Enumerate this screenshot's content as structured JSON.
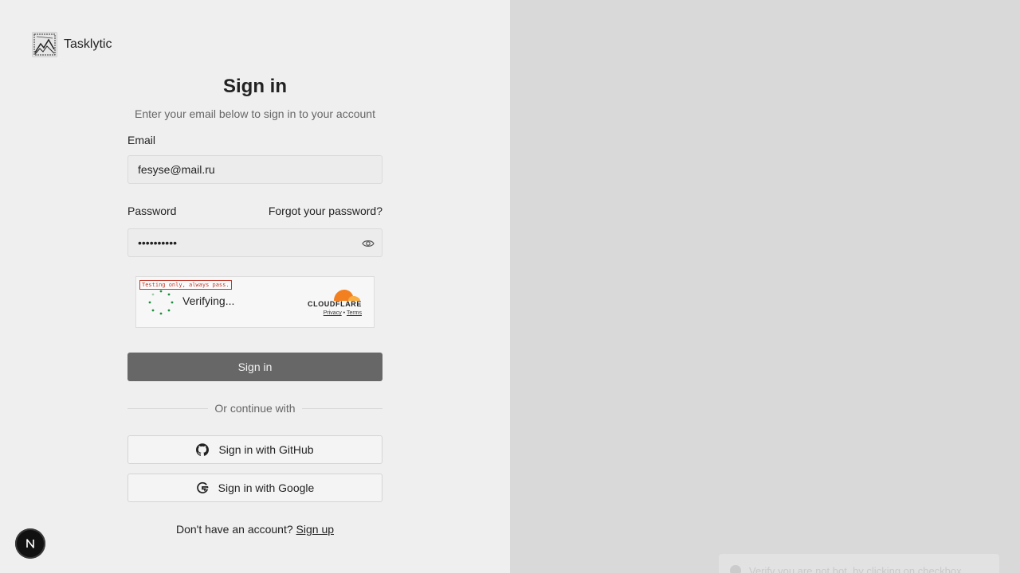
{
  "brand": {
    "name": "Tasklytic",
    "logo_icon": "mountain-chart-logo-icon"
  },
  "form": {
    "title": "Sign in",
    "subtitle": "Enter your email below to sign in to your account",
    "email_label": "Email",
    "email_value": "fesyse@mail.ru",
    "password_label": "Password",
    "forgot_link": "Forgot your password?",
    "password_value": "••••••••••",
    "show_password_icon": "eye-icon",
    "submit_label": "Sign in",
    "divider_text": "Or continue with",
    "github_label": "Sign in with GitHub",
    "github_icon": "github-icon",
    "google_label": "Sign in with Google",
    "google_icon": "google-icon",
    "signup_prompt": "Don't have an account?",
    "signup_link": "Sign up"
  },
  "captcha": {
    "test_notice": "Testing only, always pass.",
    "status": "Verifying...",
    "provider": "CLOUDFLARE",
    "privacy_link": "Privacy",
    "separator": "•",
    "terms_link": "Terms",
    "spinner_color": "#1e8e3e",
    "logo_color": "#f38020"
  },
  "dev_badge": {
    "letter": "N"
  },
  "toast": {
    "text": "Verify you are not bot, by clicking on checkbox"
  },
  "colors": {
    "left_bg": "#efefef",
    "right_bg": "#d9d9d9",
    "button_bg": "#676767"
  }
}
